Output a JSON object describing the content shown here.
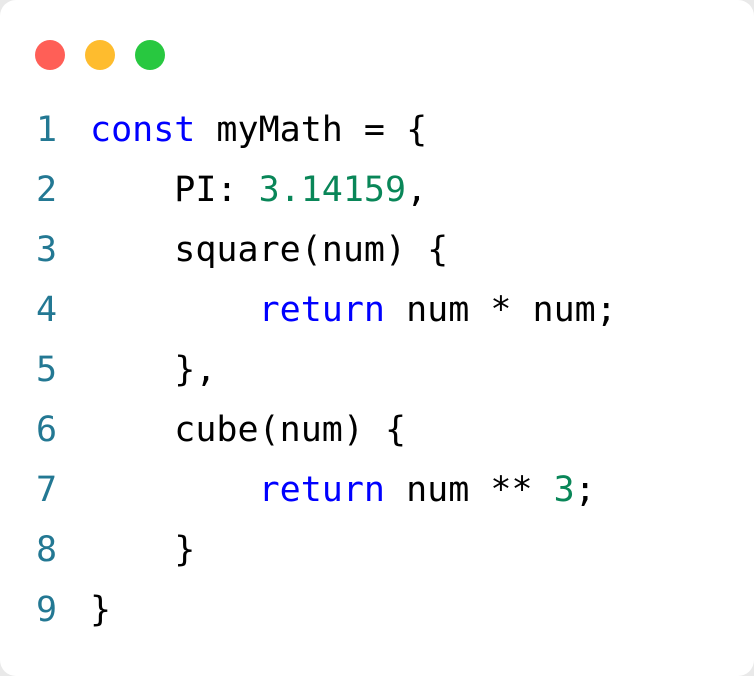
{
  "window": {
    "controls": [
      {
        "name": "close",
        "color": "#ff5f57"
      },
      {
        "name": "minimize",
        "color": "#febc2e"
      },
      {
        "name": "maximize",
        "color": "#28c840"
      }
    ]
  },
  "colors": {
    "keyword": "#0000ff",
    "number": "#098658",
    "text": "#000000",
    "line_number": "#237893"
  },
  "code": {
    "language": "javascript",
    "lines": [
      {
        "n": "1",
        "tokens": [
          {
            "t": "const",
            "k": "keyword"
          },
          {
            "t": " myMath = {",
            "k": "text"
          }
        ]
      },
      {
        "n": "2",
        "tokens": [
          {
            "t": "    PI: ",
            "k": "text"
          },
          {
            "t": "3.14159",
            "k": "number"
          },
          {
            "t": ",",
            "k": "text"
          }
        ]
      },
      {
        "n": "3",
        "tokens": [
          {
            "t": "    square(num) {",
            "k": "text"
          }
        ]
      },
      {
        "n": "4",
        "tokens": [
          {
            "t": "        ",
            "k": "text"
          },
          {
            "t": "return",
            "k": "keyword"
          },
          {
            "t": " num * num;",
            "k": "text"
          }
        ]
      },
      {
        "n": "5",
        "tokens": [
          {
            "t": "    },",
            "k": "text"
          }
        ]
      },
      {
        "n": "6",
        "tokens": [
          {
            "t": "    cube(num) {",
            "k": "text"
          }
        ]
      },
      {
        "n": "7",
        "tokens": [
          {
            "t": "        ",
            "k": "text"
          },
          {
            "t": "return",
            "k": "keyword"
          },
          {
            "t": " num ** ",
            "k": "text"
          },
          {
            "t": "3",
            "k": "number"
          },
          {
            "t": ";",
            "k": "text"
          }
        ]
      },
      {
        "n": "8",
        "tokens": [
          {
            "t": "    }",
            "k": "text"
          }
        ]
      },
      {
        "n": "9",
        "tokens": [
          {
            "t": "}",
            "k": "text"
          }
        ]
      }
    ]
  }
}
